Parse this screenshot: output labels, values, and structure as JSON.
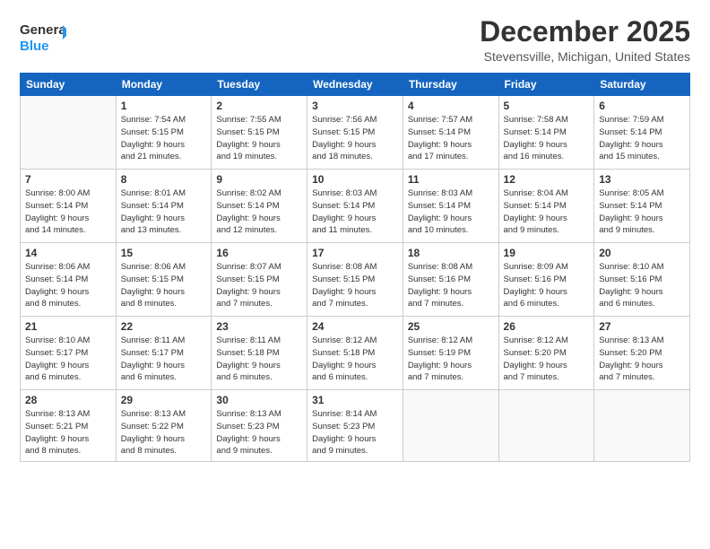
{
  "header": {
    "logo_line1": "General",
    "logo_line2": "Blue",
    "month": "December 2025",
    "location": "Stevensville, Michigan, United States"
  },
  "weekdays": [
    "Sunday",
    "Monday",
    "Tuesday",
    "Wednesday",
    "Thursday",
    "Friday",
    "Saturday"
  ],
  "weeks": [
    [
      {
        "day": "",
        "info": ""
      },
      {
        "day": "1",
        "info": "Sunrise: 7:54 AM\nSunset: 5:15 PM\nDaylight: 9 hours\nand 21 minutes."
      },
      {
        "day": "2",
        "info": "Sunrise: 7:55 AM\nSunset: 5:15 PM\nDaylight: 9 hours\nand 19 minutes."
      },
      {
        "day": "3",
        "info": "Sunrise: 7:56 AM\nSunset: 5:15 PM\nDaylight: 9 hours\nand 18 minutes."
      },
      {
        "day": "4",
        "info": "Sunrise: 7:57 AM\nSunset: 5:14 PM\nDaylight: 9 hours\nand 17 minutes."
      },
      {
        "day": "5",
        "info": "Sunrise: 7:58 AM\nSunset: 5:14 PM\nDaylight: 9 hours\nand 16 minutes."
      },
      {
        "day": "6",
        "info": "Sunrise: 7:59 AM\nSunset: 5:14 PM\nDaylight: 9 hours\nand 15 minutes."
      }
    ],
    [
      {
        "day": "7",
        "info": "Sunrise: 8:00 AM\nSunset: 5:14 PM\nDaylight: 9 hours\nand 14 minutes."
      },
      {
        "day": "8",
        "info": "Sunrise: 8:01 AM\nSunset: 5:14 PM\nDaylight: 9 hours\nand 13 minutes."
      },
      {
        "day": "9",
        "info": "Sunrise: 8:02 AM\nSunset: 5:14 PM\nDaylight: 9 hours\nand 12 minutes."
      },
      {
        "day": "10",
        "info": "Sunrise: 8:03 AM\nSunset: 5:14 PM\nDaylight: 9 hours\nand 11 minutes."
      },
      {
        "day": "11",
        "info": "Sunrise: 8:03 AM\nSunset: 5:14 PM\nDaylight: 9 hours\nand 10 minutes."
      },
      {
        "day": "12",
        "info": "Sunrise: 8:04 AM\nSunset: 5:14 PM\nDaylight: 9 hours\nand 9 minutes."
      },
      {
        "day": "13",
        "info": "Sunrise: 8:05 AM\nSunset: 5:14 PM\nDaylight: 9 hours\nand 9 minutes."
      }
    ],
    [
      {
        "day": "14",
        "info": "Sunrise: 8:06 AM\nSunset: 5:14 PM\nDaylight: 9 hours\nand 8 minutes."
      },
      {
        "day": "15",
        "info": "Sunrise: 8:06 AM\nSunset: 5:15 PM\nDaylight: 9 hours\nand 8 minutes."
      },
      {
        "day": "16",
        "info": "Sunrise: 8:07 AM\nSunset: 5:15 PM\nDaylight: 9 hours\nand 7 minutes."
      },
      {
        "day": "17",
        "info": "Sunrise: 8:08 AM\nSunset: 5:15 PM\nDaylight: 9 hours\nand 7 minutes."
      },
      {
        "day": "18",
        "info": "Sunrise: 8:08 AM\nSunset: 5:16 PM\nDaylight: 9 hours\nand 7 minutes."
      },
      {
        "day": "19",
        "info": "Sunrise: 8:09 AM\nSunset: 5:16 PM\nDaylight: 9 hours\nand 6 minutes."
      },
      {
        "day": "20",
        "info": "Sunrise: 8:10 AM\nSunset: 5:16 PM\nDaylight: 9 hours\nand 6 minutes."
      }
    ],
    [
      {
        "day": "21",
        "info": "Sunrise: 8:10 AM\nSunset: 5:17 PM\nDaylight: 9 hours\nand 6 minutes."
      },
      {
        "day": "22",
        "info": "Sunrise: 8:11 AM\nSunset: 5:17 PM\nDaylight: 9 hours\nand 6 minutes."
      },
      {
        "day": "23",
        "info": "Sunrise: 8:11 AM\nSunset: 5:18 PM\nDaylight: 9 hours\nand 6 minutes."
      },
      {
        "day": "24",
        "info": "Sunrise: 8:12 AM\nSunset: 5:18 PM\nDaylight: 9 hours\nand 6 minutes."
      },
      {
        "day": "25",
        "info": "Sunrise: 8:12 AM\nSunset: 5:19 PM\nDaylight: 9 hours\nand 7 minutes."
      },
      {
        "day": "26",
        "info": "Sunrise: 8:12 AM\nSunset: 5:20 PM\nDaylight: 9 hours\nand 7 minutes."
      },
      {
        "day": "27",
        "info": "Sunrise: 8:13 AM\nSunset: 5:20 PM\nDaylight: 9 hours\nand 7 minutes."
      }
    ],
    [
      {
        "day": "28",
        "info": "Sunrise: 8:13 AM\nSunset: 5:21 PM\nDaylight: 9 hours\nand 8 minutes."
      },
      {
        "day": "29",
        "info": "Sunrise: 8:13 AM\nSunset: 5:22 PM\nDaylight: 9 hours\nand 8 minutes."
      },
      {
        "day": "30",
        "info": "Sunrise: 8:13 AM\nSunset: 5:23 PM\nDaylight: 9 hours\nand 9 minutes."
      },
      {
        "day": "31",
        "info": "Sunrise: 8:14 AM\nSunset: 5:23 PM\nDaylight: 9 hours\nand 9 minutes."
      },
      {
        "day": "",
        "info": ""
      },
      {
        "day": "",
        "info": ""
      },
      {
        "day": "",
        "info": ""
      }
    ]
  ]
}
